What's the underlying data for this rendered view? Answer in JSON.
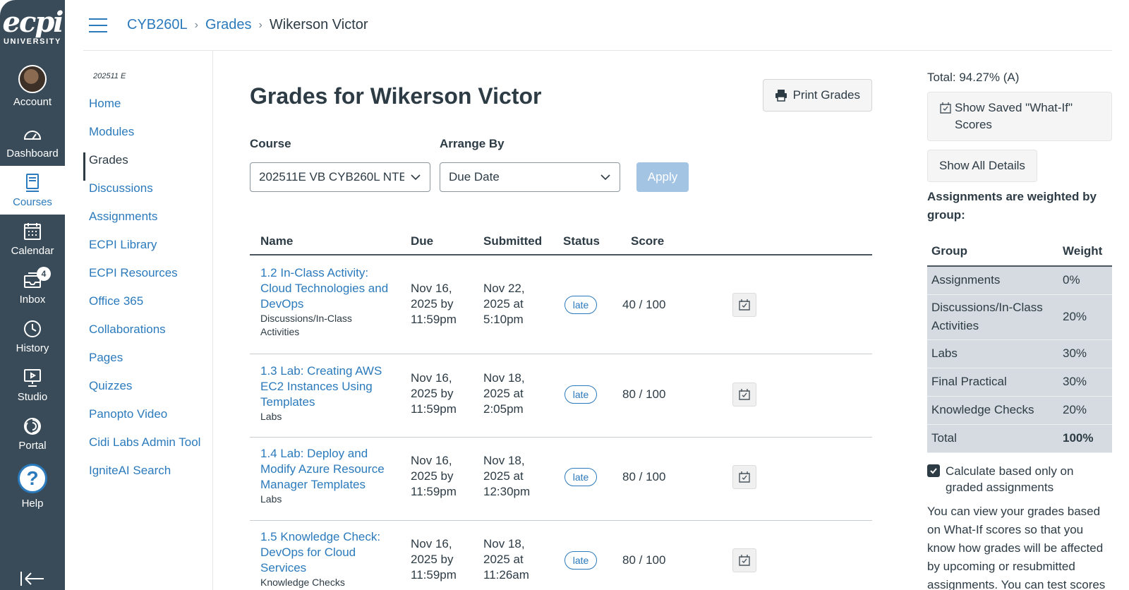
{
  "brand": {
    "logo_big": "ecpi",
    "logo_small": "UNIVERSITY"
  },
  "global_nav": [
    {
      "label": "Account",
      "icon": "avatar"
    },
    {
      "label": "Dashboard",
      "icon": "dashboard-icon"
    },
    {
      "label": "Courses",
      "icon": "courses-icon",
      "active": true
    },
    {
      "label": "Calendar",
      "icon": "calendar-icon"
    },
    {
      "label": "Inbox",
      "icon": "inbox-icon",
      "badge": "4"
    },
    {
      "label": "History",
      "icon": "history-icon"
    },
    {
      "label": "Studio",
      "icon": "studio-icon"
    },
    {
      "label": "Portal",
      "icon": "portal-icon"
    },
    {
      "label": "Help",
      "icon": "help-icon"
    }
  ],
  "breadcrumb": [
    "CYB260L",
    "Grades",
    "Wikerson Victor"
  ],
  "course_nav": {
    "term": "202511 E",
    "items": [
      "Home",
      "Modules",
      "Grades",
      "Discussions",
      "Assignments",
      "ECPI Library",
      "ECPI Resources",
      "Office 365",
      "Collaborations",
      "Pages",
      "Quizzes",
      "Panopto Video",
      "Cidi Labs Admin Tool",
      "IgniteAI Search"
    ],
    "active": "Grades"
  },
  "main": {
    "title": "Grades for Wikerson Victor",
    "print_label": "Print Grades",
    "course_label": "Course",
    "course_value": "202511E VB CYB260L NTE",
    "arrange_label": "Arrange By",
    "arrange_value": "Due Date",
    "apply_label": "Apply",
    "columns": [
      "Name",
      "Due",
      "Submitted",
      "Status",
      "Score"
    ],
    "rows": [
      {
        "name": [
          "1.2 In-Class Activity:",
          "Cloud Technologies and",
          "DevOps"
        ],
        "group": [
          "Discussions/In-Class",
          "Activities"
        ],
        "due": [
          "Nov 16,",
          "2025 by",
          "11:59pm"
        ],
        "submitted": [
          "Nov 22,",
          "2025 at",
          "5:10pm"
        ],
        "status": "late",
        "score": "40 / 100"
      },
      {
        "name": [
          "1.3 Lab: Creating AWS",
          "EC2 Instances Using",
          "Templates"
        ],
        "group": [
          "Labs"
        ],
        "due": [
          "Nov 16,",
          "2025 by",
          "11:59pm"
        ],
        "submitted": [
          "Nov 18,",
          "2025 at",
          "2:05pm"
        ],
        "status": "late",
        "score": "80 / 100"
      },
      {
        "name": [
          "1.4 Lab: Deploy and",
          "Modify Azure Resource",
          "Manager Templates"
        ],
        "group": [
          "Labs"
        ],
        "due": [
          "Nov 16,",
          "2025 by",
          "11:59pm"
        ],
        "submitted": [
          "Nov 18,",
          "2025 at",
          "12:30pm"
        ],
        "status": "late",
        "score": "80 / 100"
      },
      {
        "name": [
          "1.5 Knowledge Check:",
          "DevOps for Cloud",
          "Services"
        ],
        "group": [
          "Knowledge Checks"
        ],
        "due": [
          "Nov 16,",
          "2025 by",
          "11:59pm"
        ],
        "submitted": [
          "Nov 18,",
          "2025 at",
          "11:26am"
        ],
        "status": "late",
        "score": "80 / 100"
      }
    ]
  },
  "sidebar": {
    "total": "Total: 94.27% (A)",
    "saved_whatif": "Show Saved \"What-If\" Scores",
    "show_details": "Show All Details",
    "weighted_title": "Assignments are weighted by group:",
    "weight_headers": [
      "Group",
      "Weight"
    ],
    "weights": [
      {
        "group": "Assignments",
        "weight": "0%"
      },
      {
        "group": "Discussions/In-Class Activities",
        "weight": "20%"
      },
      {
        "group": "Labs",
        "weight": "30%"
      },
      {
        "group": "Final Practical",
        "weight": "30%"
      },
      {
        "group": "Knowledge Checks",
        "weight": "20%"
      },
      {
        "group": "Total",
        "weight": "100%"
      }
    ],
    "calc_label": "Calculate based only on graded assignments",
    "note": "You can view your grades based on What-If scores so that you know how grades will be affected by upcoming or resubmitted assignments. You can test scores"
  }
}
